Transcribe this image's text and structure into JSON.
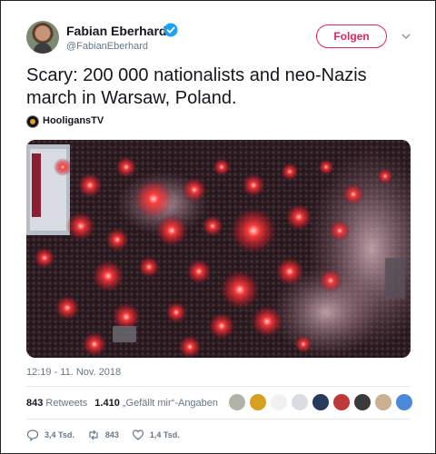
{
  "user": {
    "name": "Fabian Eberhard",
    "handle": "@FabianEberhard",
    "follow_label": "Folgen",
    "avatar_icon": "avatar",
    "verified_icon": "verified-badge-icon"
  },
  "tweet": {
    "line1": "Scary: 200 000 nationalists and neo-Nazis",
    "line2": "march in Warsaw, Poland."
  },
  "source": {
    "name": "HooligansTV"
  },
  "timestamp": "12:19 - 11. Nov. 2018",
  "stats": {
    "retweets_count": "843",
    "retweets_label": "Retweets",
    "likes_count": "1.410",
    "likes_label": "„Gefällt mir“-Angaben"
  },
  "liker_colors": [
    "#b0b4a8",
    "#d8a020",
    "#f0f0f0",
    "#d9dde2",
    "#2a3a5a",
    "#c03838",
    "#3a3a3a",
    "#c8b090",
    "#4a8ad8"
  ],
  "actions": {
    "replies": "3,4 Tsd.",
    "retweets": "843",
    "likes": "1,4 Tsd."
  },
  "colors": {
    "accent": "#e0245e",
    "verified": "#1da1f2",
    "muted": "#657786"
  }
}
